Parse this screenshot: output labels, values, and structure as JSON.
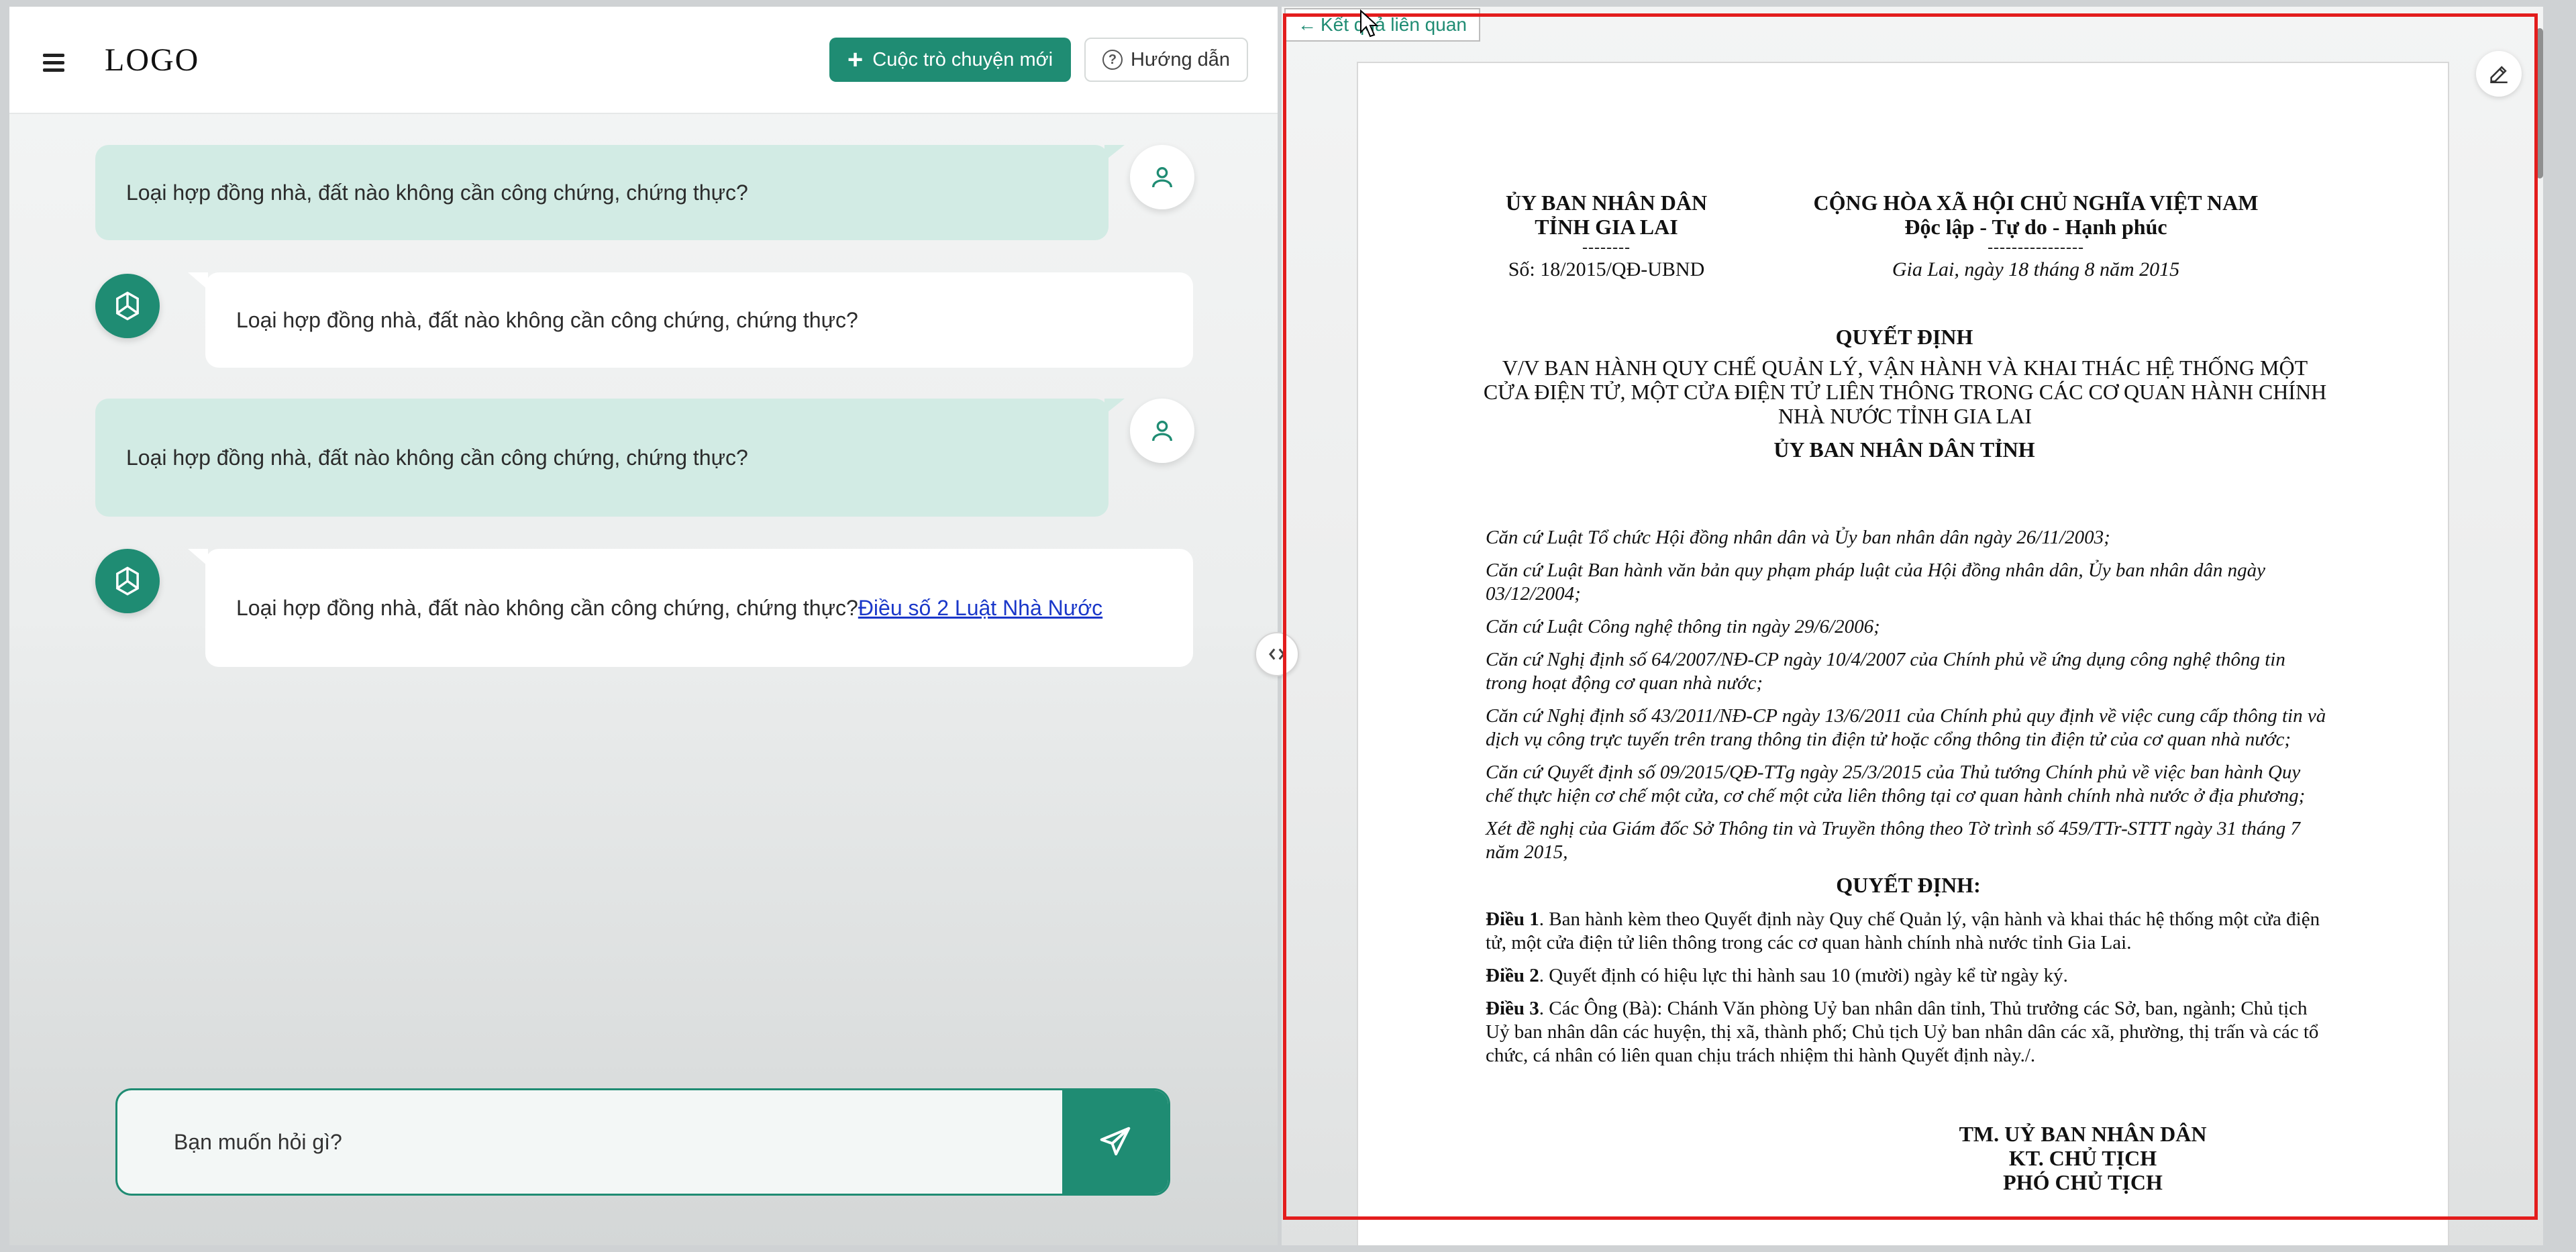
{
  "header": {
    "logo": "LOGO",
    "new_chat_label": "Cuộc trò chuyện mới",
    "help_label": "Hướng dẫn"
  },
  "chat": {
    "messages": [
      {
        "role": "user",
        "text": "Loại hợp đồng nhà, đất nào không cần công chứng, chứng thực?"
      },
      {
        "role": "bot",
        "text": "Loại hợp đồng nhà, đất nào không cần công chứng, chứng thực?"
      },
      {
        "role": "user",
        "text": "Loại hợp đồng nhà, đất nào không cần công chứng, chứng thực?"
      },
      {
        "role": "bot",
        "text": "Loại hợp đồng nhà, đất nào không cần công chứng, chứng thực?",
        "link": "Điều số 2 Luật Nhà Nước"
      }
    ]
  },
  "composer": {
    "placeholder": "Bạn muốn hỏi gì?"
  },
  "panel": {
    "back_label": "Kết quả liên quan"
  },
  "document": {
    "left_header": [
      "ỦY BAN NHÂN DÂN",
      "TỈNH GIA LAI"
    ],
    "left_dash": "--------",
    "number": "Số: 18/2015/QĐ-UBND",
    "right_header": [
      "CỘNG HÒA XÃ HỘI CHỦ NGHĨA VIỆT NAM",
      "Độc lập - Tự do - Hạnh phúc"
    ],
    "right_dash": "----------------",
    "date": "Gia Lai, ngày 18 tháng 8 năm 2015",
    "title": "QUYẾT ĐỊNH",
    "subject": "V/V BAN HÀNH QUY CHẾ QUẢN LÝ, VẬN HÀNH VÀ KHAI THÁC HỆ THỐNG MỘT CỬA ĐIỆN TỬ, MỘT CỬA ĐIỆN TỬ LIÊN THÔNG TRONG CÁC CƠ QUAN HÀNH CHÍNH NHÀ NƯỚC TỈNH GIA LAI",
    "authority": "ỦY BAN NHÂN DÂN TỈNH",
    "bases": [
      "Căn cứ Luật Tổ chức Hội đồng nhân dân và Ủy ban nhân dân ngày 26/11/2003;",
      "Căn cứ Luật Ban hành văn bản quy phạm pháp luật của Hội đồng nhân dân, Ủy ban nhân dân ngày 03/12/2004;",
      "Căn cứ Luật Công nghệ thông tin ngày 29/6/2006;",
      "Căn cứ Nghị định số 64/2007/NĐ-CP ngày 10/4/2007 của Chính phủ về ứng dụng công nghệ thông tin trong hoạt động cơ quan nhà nước;",
      "Căn cứ Nghị định số 43/2011/NĐ-CP ngày 13/6/2011 của Chính phủ quy định về việc cung cấp thông tin và dịch vụ công trực tuyến trên trang thông tin điện tử hoặc cổng thông tin điện tử của cơ quan nhà nước;",
      "Căn cứ Quyết định số 09/2015/QĐ-TTg ngày 25/3/2015 của Thủ tướng Chính phủ về việc ban hành Quy chế thực hiện cơ chế một cửa, cơ chế một cửa liên thông tại cơ quan hành chính nhà nước ở địa phương;",
      "Xét đề nghị của Giám đốc Sở Thông tin và Truyền thông theo Tờ trình số 459/TTr-STTT ngày 31 tháng 7 năm 2015,"
    ],
    "decision_heading": "QUYẾT ĐỊNH:",
    "articles": [
      {
        "label": "Điều 1",
        "text": ". Ban hành kèm theo Quyết định này Quy chế Quản lý, vận hành và khai thác hệ thống một cửa điện tử, một cửa điện tử liên thông trong các cơ quan hành chính nhà nước tỉnh Gia Lai."
      },
      {
        "label": "Điều 2",
        "text": ". Quyết định có hiệu lực thi hành sau 10 (mười) ngày kể từ ngày ký."
      },
      {
        "label": "Điều 3",
        "text": ". Các Ông (Bà): Chánh Văn phòng Uỷ ban nhân dân tỉnh, Thủ trưởng các Sở, ban, ngành; Chủ tịch Uỷ ban nhân dân các huyện, thị xã, thành phố; Chủ tịch Uỷ ban nhân dân các xã, phường, thị trấn và các tổ chức, cá nhân có liên quan chịu trách nhiệm thi hành Quyết định này./."
      }
    ],
    "signature": [
      "TM. UỶ BAN NHÂN DÂN",
      "KT. CHỦ TỊCH",
      "PHÓ CHỦ TỊCH"
    ]
  },
  "colors": {
    "accent": "#1f8c73",
    "user_bubble": "#d2ebe4",
    "link": "#1a37c9",
    "highlight_frame": "#e31d1d"
  },
  "icons": [
    "menu-icon",
    "plus-icon",
    "help-icon",
    "user-icon",
    "bot-icon",
    "send-icon",
    "collapse-toggle-icon",
    "arrow-left-icon",
    "edit-icon"
  ]
}
